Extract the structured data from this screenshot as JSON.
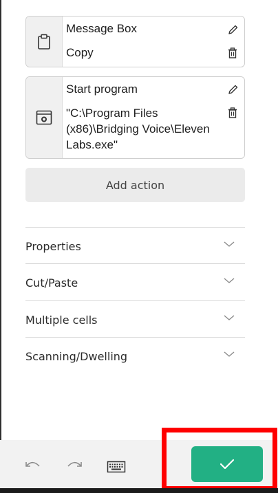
{
  "actions": [
    {
      "title": "Message Box",
      "subtitle": "Copy",
      "icon": "clipboard-icon"
    },
    {
      "title": "Start program",
      "subtitle": "\"C:\\Program Files (x86)\\Bridging Voice\\Eleven Labs.exe\"",
      "icon": "program-window-icon"
    }
  ],
  "add_action_label": "Add action",
  "sections": [
    {
      "label": "Properties"
    },
    {
      "label": "Cut/Paste"
    },
    {
      "label": "Multiple cells"
    },
    {
      "label": "Scanning/Dwelling"
    }
  ],
  "toolbar": {
    "icons": [
      "undo-icon",
      "redo-icon",
      "keyboard-icon"
    ],
    "confirm_icon": "checkmark-icon"
  },
  "colors": {
    "confirm_button": "#22b084",
    "highlight_border": "#ff0000"
  }
}
